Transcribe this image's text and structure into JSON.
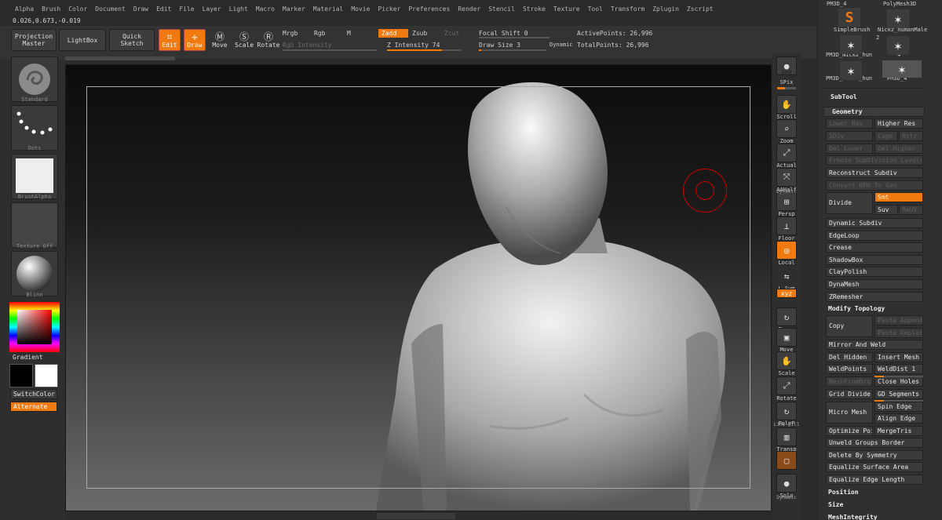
{
  "menu": [
    "Alpha",
    "Brush",
    "Color",
    "Document",
    "Draw",
    "Edit",
    "File",
    "Layer",
    "Light",
    "Macro",
    "Marker",
    "Material",
    "Movie",
    "Picker",
    "Preferences",
    "Render",
    "Stencil",
    "Stroke",
    "Texture",
    "Tool",
    "Transform",
    "Zplugin",
    "Zscript"
  ],
  "coords": "0.026,0.673,-0.019",
  "shelf": {
    "projection_master": "Projection\nMaster",
    "lightbox": "LightBox",
    "quick_sketch": "Quick\nSketch",
    "edit": "Edit",
    "draw": "Draw",
    "move": "Move",
    "scale": "Scale",
    "rotate": "Rotate",
    "mrgb": "Mrgb",
    "rgb": "Rgb",
    "m": "M",
    "zadd": "Zadd",
    "zsub": "Zsub",
    "zcut": "Zcut",
    "rgb_intensity": "Rgb Intensity",
    "z_intensity": "Z Intensity 74",
    "focal_shift": "Focal Shift 0",
    "draw_size": "Draw Size 3",
    "dynamic": "Dynamic",
    "active_points": "ActivePoints: 26,996",
    "total_points": "TotalPoints: 26,996"
  },
  "levels": {
    "z_intensity": 0.74,
    "focal_shift": 0.0,
    "draw_size": 0.03
  },
  "left": {
    "brush": "Standard",
    "stroke": "Dots",
    "alpha": "BrushAlpha",
    "texture": "Texture Off",
    "material": "Blinn",
    "gradient": "Gradient",
    "switchcolor": "SwitchColor",
    "alternate": "Alternate"
  },
  "right_toolbar": [
    "BPR",
    "SPix",
    "Scroll",
    "Zoom",
    "Actual",
    "AAHalf",
    "Persp",
    "Floor",
    "Local",
    "L.Sym",
    "XYZ",
    "Frame",
    "Move",
    "Scale",
    "Rotate",
    "PolyF",
    "Transp",
    "Ghost",
    "Solo"
  ],
  "right_toolbar_sublabels": {
    "dynamic1": "Dynamic",
    "linefill": "Line Fill",
    "dynamic2": "Dynamic"
  },
  "subtool_thumbs": [
    "PM3D_4",
    "PolyMesh3D",
    "SimpleBrush",
    "Nickz_humanMale",
    "2",
    "PM3D_Nickz_hun",
    "4",
    "PM3D_Nickz_hun",
    "PM3D_4"
  ],
  "palette": {
    "subtool": "SubTool",
    "geometry": "Geometry",
    "lower_res": "Lower Res",
    "higher_res": "Higher Res",
    "sdiv": "SDiv",
    "cage": "Cage",
    "rstr": "Rstr",
    "del_lower": "Del Lower",
    "del_higher": "Del Higher",
    "freeze": "Freeze SubDivision Levels",
    "reconstruct": "Reconstruct Subdiv",
    "convert_bpr": "Convert BPR To Geo",
    "divide": "Divide",
    "smt": "Smt",
    "suv": "Suv",
    "reluv": "ReUV",
    "dynamic_subdiv": "Dynamic Subdiv",
    "edgeloop": "EdgeLoop",
    "crease": "Crease",
    "shadowbox": "ShadowBox",
    "claypolish": "ClayPolish",
    "dynamesh": "DynaMesh",
    "zremesher": "ZRemesher",
    "modify_topology": "Modify Topology",
    "copy": "Copy",
    "paste_append": "Paste Append",
    "paste_replace": "Paste Replace",
    "mirror_weld": "Mirror And Weld",
    "del_hidden": "Del Hidden",
    "insert_mesh": "Insert Mesh",
    "weldpoints": "WeldPoints",
    "welddist": "WeldDist 1",
    "meshfromb": "MeshFromBru",
    "close_holes": "Close Holes",
    "grid_divide": "Grid Divide",
    "gd_segments": "GD Segments",
    "micro_mesh": "Micro Mesh",
    "spin_edge": "Spin Edge",
    "align_edge": "Align Edge",
    "optimize_points": "Optimize Poi",
    "mergetris": "MergeTris",
    "unweld_groups": "Unweld Groups Border",
    "delete_by_symmetry": "Delete By Symmetry",
    "equalize_surface": "Equalize Surface Area",
    "equalize_edge": "Equalize Edge Length",
    "position": "Position",
    "size": "Size",
    "meshintegrity": "MeshIntegrity"
  },
  "colors": {
    "accent": "#f07a10",
    "panel": "#303030",
    "canvas_top": "#0c0c0c",
    "canvas_bottom": "#6b6b6b"
  }
}
